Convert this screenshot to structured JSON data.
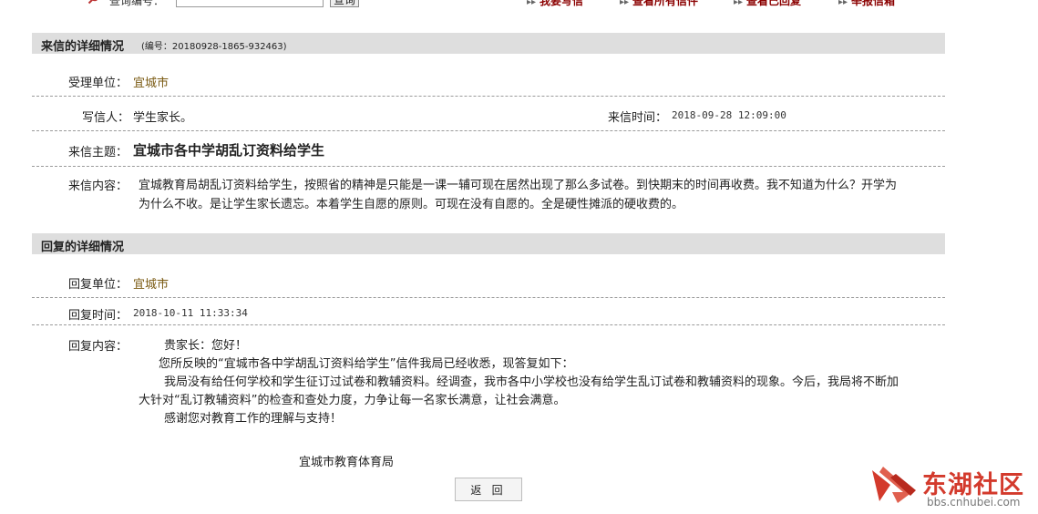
{
  "topbar": {
    "search_label": "查询编号：",
    "search_value": "",
    "search_button": "查询",
    "links": [
      "我要写信",
      "查看所有信件",
      "查看已回复",
      "举报信箱"
    ]
  },
  "letter": {
    "header_title": "来信的详细情况",
    "header_number": "(编号：20180928-1865-932463)",
    "unit_label": "受理单位：",
    "unit_value": "宜城市",
    "writer_label": "写信人：",
    "writer_value": "学生家长。",
    "time_label": "来信时间：",
    "time_value": "2018-09-28 12:09:00",
    "subject_label": "来信主题：",
    "subject_value": "宜城市各中学胡乱订资料给学生",
    "content_label": "来信内容：",
    "content_value": "宜城教育局胡乱订资料给学生，按照省的精神是只能是一课一辅可现在居然出现了那么多试卷。到快期末的时间再收费。我不知道为什么？开学为为什么不收。是让学生家长遗忘。本着学生自愿的原则。可现在没有自愿的。全是硬性摊派的硬收费的。"
  },
  "reply": {
    "header_title": "回复的详细情况",
    "unit_label": "回复单位：",
    "unit_value": "宜城市",
    "time_label": "回复时间：",
    "time_value": "2018-10-11 11:33:34",
    "content_label": "回复内容：",
    "greeting": "贵家长：您好！",
    "para1": "您所反映的“宜城市各中学胡乱订资料给学生”信件我局已经收悉，现答复如下：",
    "para2": "我局没有给任何学校和学生征订过试卷和教辅资料。经调查，我市各中小学校也没有给学生乱订试卷和教辅资料的现象。今后，我局将不断加大针对“乱订教辅资料”的检查和查处力度，力争让每一名家长满意，让社会满意。",
    "para3": "感谢您对教育工作的理解与支持！",
    "signature": "宜城市教育体育局",
    "back_button": "返 回"
  },
  "watermark": {
    "name": "东湖社区",
    "url": "bbs.cnhubei.com",
    "color": "#d33a2c"
  }
}
